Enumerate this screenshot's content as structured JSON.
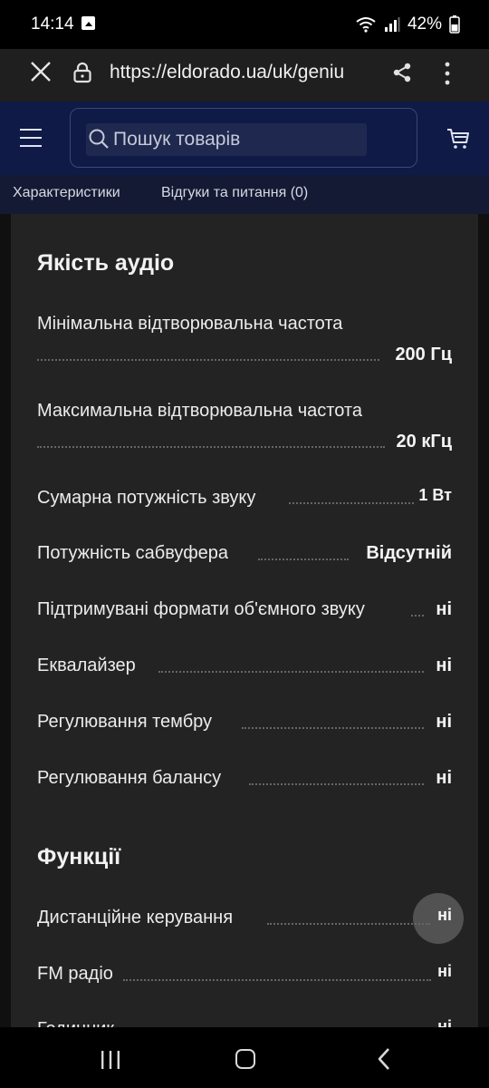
{
  "status_bar": {
    "time": "14:14",
    "battery": "42%"
  },
  "browser": {
    "url": "https://eldorado.ua/uk/geniu"
  },
  "header": {
    "search_placeholder": "Пошук товарів"
  },
  "tabs": [
    {
      "label": "Характеристики"
    },
    {
      "label": "Відгуки та питання (0)"
    }
  ],
  "sections": [
    {
      "title": "Якість аудіо",
      "rows": [
        {
          "label": "Мінімальна відтворювальна частота",
          "value": "200 Гц"
        },
        {
          "label": "Максимальна відтворювальна частота",
          "value": "20 кГц"
        },
        {
          "label": "Сумарна потужність звуку",
          "value": "1 Вт"
        },
        {
          "label": "Потужність сабвуфера",
          "value": "Відсутній"
        },
        {
          "label": "Підтримувані формати об'ємного звуку",
          "value": "ні"
        },
        {
          "label": "Еквалайзер",
          "value": "ні"
        },
        {
          "label": "Регулювання тембру",
          "value": "ні"
        },
        {
          "label": "Регулювання балансу",
          "value": "ні"
        }
      ]
    },
    {
      "title": "Функції",
      "rows": [
        {
          "label": "Дистанційне керування",
          "value": "ні"
        },
        {
          "label": "FM радіо",
          "value": "ні"
        },
        {
          "label": "Годинник",
          "value": "ні"
        }
      ]
    }
  ]
}
